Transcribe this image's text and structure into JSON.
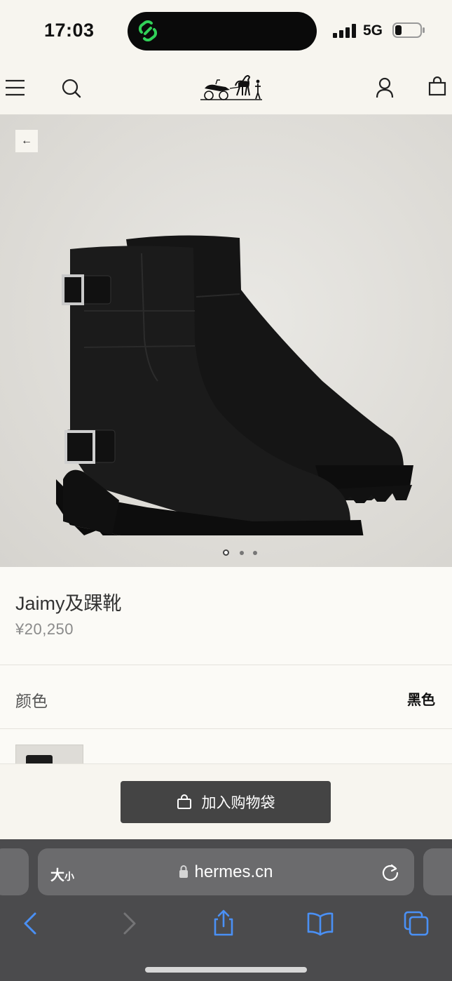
{
  "status_bar": {
    "time": "17:03",
    "network": "5G",
    "island_icon": "link-icon",
    "accent_color": "#31d158"
  },
  "nav": {
    "menu_icon": "menu-icon",
    "search_icon": "search-icon",
    "logo": "hermes-carriage-logo",
    "account_icon": "user-icon",
    "bag_icon": "shopping-bag-icon"
  },
  "hero": {
    "back_label": "←",
    "carousel": {
      "count": 3,
      "active_index": 0
    }
  },
  "product": {
    "name": "Jaimy及踝靴",
    "price": "¥20,250"
  },
  "color": {
    "label": "颜色",
    "value": "黑色"
  },
  "cta": {
    "label": "加入购物袋",
    "icon": "shopping-bag-icon"
  },
  "browser": {
    "text_size_label": "大",
    "text_size_small": "小",
    "url": "hermes.cn",
    "icons": [
      "back-arrow-icon",
      "forward-arrow-icon",
      "share-icon",
      "bookmarks-icon",
      "tabs-icon"
    ]
  }
}
